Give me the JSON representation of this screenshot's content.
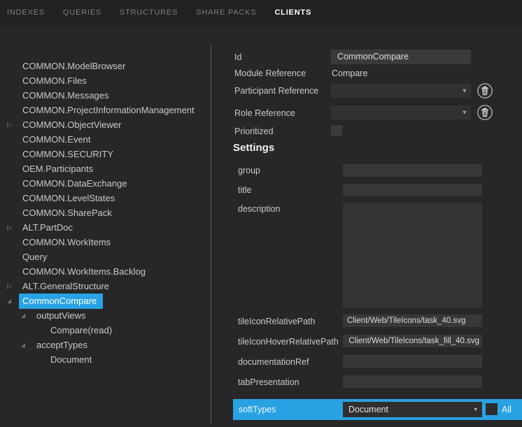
{
  "tabs": {
    "items": [
      {
        "label": "INDEXES",
        "active": false
      },
      {
        "label": "QUERIES",
        "active": false
      },
      {
        "label": "STRUCTURES",
        "active": false
      },
      {
        "label": "SHARE PACKS",
        "active": false
      },
      {
        "label": "CLIENTS",
        "active": true
      }
    ]
  },
  "tree": {
    "items": [
      {
        "label": "COMMON.ModelBrowser",
        "level": 0,
        "expander": "none",
        "selected": false
      },
      {
        "label": "COMMON.Files",
        "level": 0,
        "expander": "none",
        "selected": false
      },
      {
        "label": "COMMON.Messages",
        "level": 0,
        "expander": "none",
        "selected": false
      },
      {
        "label": "COMMON.ProjectInformationManagement",
        "level": 0,
        "expander": "none",
        "selected": false
      },
      {
        "label": "COMMON.ObjectViewer",
        "level": 0,
        "expander": "collapsed",
        "selected": false
      },
      {
        "label": "COMMON.Event",
        "level": 0,
        "expander": "none",
        "selected": false
      },
      {
        "label": "COMMON.SECURITY",
        "level": 0,
        "expander": "none",
        "selected": false
      },
      {
        "label": "OEM.Participants",
        "level": 0,
        "expander": "none",
        "selected": false
      },
      {
        "label": "COMMON.DataExchange",
        "level": 0,
        "expander": "none",
        "selected": false
      },
      {
        "label": "COMMON.LevelStates",
        "level": 0,
        "expander": "none",
        "selected": false
      },
      {
        "label": "COMMON.SharePack",
        "level": 0,
        "expander": "none",
        "selected": false
      },
      {
        "label": "ALT.PartDoc",
        "level": 0,
        "expander": "collapsed",
        "selected": false
      },
      {
        "label": "COMMON.WorkItems",
        "level": 0,
        "expander": "none",
        "selected": false
      },
      {
        "label": "Query",
        "level": 0,
        "expander": "none",
        "selected": false
      },
      {
        "label": "COMMON.WorkItems.Backlog",
        "level": 0,
        "expander": "none",
        "selected": false
      },
      {
        "label": "ALT.GeneralStructure",
        "level": 0,
        "expander": "collapsed",
        "selected": false
      },
      {
        "label": "CommonCompare",
        "level": 0,
        "expander": "expanded",
        "selected": true
      },
      {
        "label": "outputViews",
        "level": 1,
        "expander": "expanded",
        "selected": false
      },
      {
        "label": "Compare(read)",
        "level": 2,
        "expander": "none",
        "selected": false
      },
      {
        "label": "acceptTypes",
        "level": 1,
        "expander": "expanded",
        "selected": false
      },
      {
        "label": "Document",
        "level": 2,
        "expander": "none",
        "selected": false
      }
    ]
  },
  "form": {
    "id": {
      "label": "Id",
      "value": "CommonCompare"
    },
    "module_reference": {
      "label": "Module Reference",
      "value": "Compare"
    },
    "participant_reference": {
      "label": "Participant Reference",
      "value": ""
    },
    "role_reference": {
      "label": "Role Reference",
      "value": ""
    },
    "prioritized": {
      "label": "Prioritized",
      "checked": false
    },
    "settings": {
      "heading": "Settings",
      "group": {
        "label": "group",
        "value": ""
      },
      "title": {
        "label": "title",
        "value": ""
      },
      "description": {
        "label": "description",
        "value": ""
      },
      "tile_icon": {
        "label": "tileIconRelativePath",
        "value": "Client/Web/TileIcons/task_40.svg"
      },
      "tile_icon_hover": {
        "label": "tileIconHoverRelativePath",
        "value": "Client/Web/TileIcons/task_fill_40.svg"
      },
      "documentation_ref": {
        "label": "documentationRef",
        "value": ""
      },
      "tab_presentation": {
        "label": "tabPresentation",
        "value": ""
      }
    },
    "soft_types": {
      "label": "softTypes",
      "selected": "Document",
      "all_label": "All",
      "all_checked": false
    }
  },
  "icons": {
    "expander_collapsed": "▷",
    "expander_expanded": "◢",
    "dropdown_arrow": "▾"
  },
  "colors": {
    "accent": "#29a2e3",
    "background": "#272727",
    "topbar": "#212121",
    "input_background": "#3a3a3a"
  }
}
